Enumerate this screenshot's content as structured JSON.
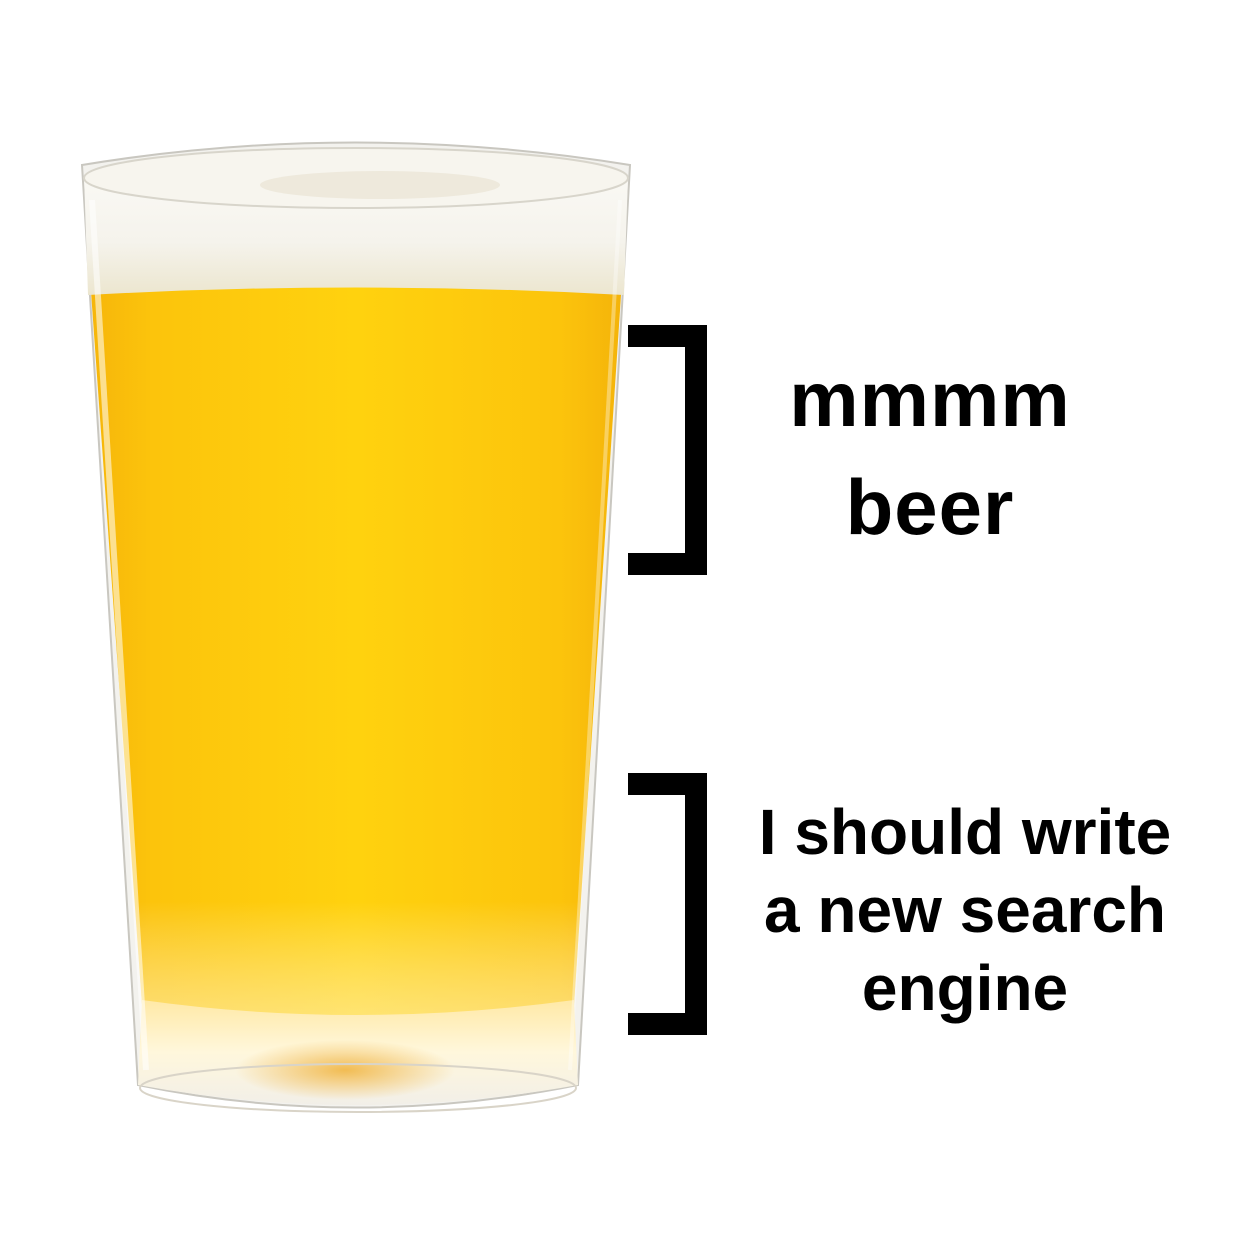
{
  "meme": {
    "upper_caption": {
      "line1": "mmmm",
      "line2": "beer"
    },
    "lower_caption": {
      "line1": "I should write",
      "line2": "a new search",
      "line3": "engine"
    }
  },
  "colors": {
    "background": "#ffffff",
    "beer": "#fcc40c",
    "foam": "#f7f6f0",
    "bracket": "#000000",
    "text": "#000000"
  }
}
